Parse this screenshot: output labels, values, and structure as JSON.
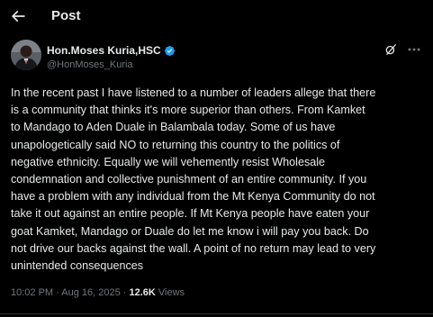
{
  "header": {
    "title": "Post",
    "back_icon": "arrow-left-icon"
  },
  "author": {
    "display_name": "Hon.Moses Kuria,HSC",
    "handle": "@HonMoses_Kuria",
    "verified_icon": "verified-badge-icon",
    "verified_color": "#1d9bf0"
  },
  "actions": {
    "grok_icon": "grok-icon",
    "more_icon": "more-horizontal-icon"
  },
  "tweet": {
    "text": "In the recent past I have listened to a number of leaders allege that there\nis a community that thinks it's more superior than others. From Kamket\nto Mandago to Aden Duale in Balambala today. Some of us have\nunapologetically said NO to returning this country to the politics of\nnegative ethnicity. Equally we will vehemently resist Wholesale\ncondemnation and collective punishment of an entire community. If you\nhave a problem with any individual from the Mt Kenya Community do not\ntake it out against an entire people. If Mt Kenya people have eaten your\ngoat Kamket, Mandago or Duale do let me know i will pay you back. Do\nnot drive our backs against the wall. A point of no return may lead to very\nunintended consequences"
  },
  "meta": {
    "time": "10:02 PM",
    "separator": " · ",
    "date": "Aug 16, 2025",
    "views_count": "12.6K",
    "views_label": " Views"
  },
  "colors": {
    "background": "#000000",
    "text_primary": "#e7e9ea",
    "text_secondary": "#71767b",
    "divider": "#2f3336"
  }
}
